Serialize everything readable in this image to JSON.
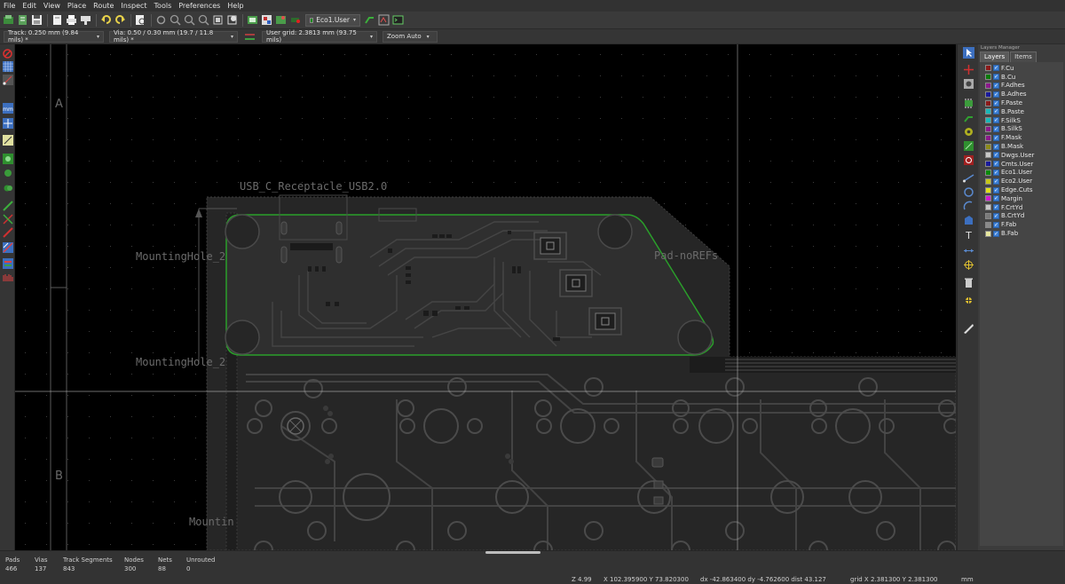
{
  "menubar": [
    "File",
    "Edit",
    "View",
    "Place",
    "Route",
    "Inspect",
    "Tools",
    "Preferences",
    "Help"
  ],
  "toolbar": {
    "layer_select": "Eco1.User"
  },
  "aux_toolbar": {
    "track": "Track: 0.250 mm (9.84 mils) *",
    "via": "Via: 0.50 / 0.30 mm (19.7 / 11.8 mils) *",
    "grid": "User grid: 2.3813 mm (93.75 mils)",
    "zoom": "Zoom Auto"
  },
  "canvas": {
    "frame_labels": [
      "A",
      "B"
    ],
    "footprint_labels": {
      "usb": "USB_C_Receptacle_USB2.0",
      "hole_1": "MountingHole_2",
      "hole_2": "MountingHole_2",
      "hole_3": "Mountin",
      "pad_ref": "Pad-noREFs"
    }
  },
  "layers_panel": {
    "title": "Layers Manager",
    "tabs": [
      "Layers",
      "Items"
    ],
    "layers": [
      {
        "name": "F.Cu",
        "color": "#8b1a1a"
      },
      {
        "name": "B.Cu",
        "color": "#0a7a0a"
      },
      {
        "name": "F.Adhes",
        "color": "#8b1a8b"
      },
      {
        "name": "B.Adhes",
        "color": "#1a1a9a"
      },
      {
        "name": "F.Paste",
        "color": "#8b1a1a"
      },
      {
        "name": "B.Paste",
        "color": "#1ab8b8"
      },
      {
        "name": "F.SilkS",
        "color": "#1ab8b8"
      },
      {
        "name": "B.SilkS",
        "color": "#8b1a8b"
      },
      {
        "name": "F.Mask",
        "color": "#8b1a8b"
      },
      {
        "name": "B.Mask",
        "color": "#8b8b1a"
      },
      {
        "name": "Dwgs.User",
        "color": "#c8c8c8"
      },
      {
        "name": "Cmts.User",
        "color": "#1a1a9a"
      },
      {
        "name": "Eco1.User",
        "color": "#0a8a0a"
      },
      {
        "name": "Eco2.User",
        "color": "#c8c81a"
      },
      {
        "name": "Edge.Cuts",
        "color": "#e0e01a"
      },
      {
        "name": "Margin",
        "color": "#d01ad0"
      },
      {
        "name": "F.CrtYd",
        "color": "#c8c8c8"
      },
      {
        "name": "B.CrtYd",
        "color": "#7a7a7a"
      },
      {
        "name": "F.Fab",
        "color": "#8a8a8a"
      },
      {
        "name": "B.Fab",
        "color": "#e8e8a0"
      }
    ]
  },
  "status": {
    "stats": [
      {
        "label": "Pads",
        "value": "466"
      },
      {
        "label": "Vias",
        "value": "137"
      },
      {
        "label": "Track Segments",
        "value": "843"
      },
      {
        "label": "Nodes",
        "value": "300"
      },
      {
        "label": "Nets",
        "value": "88"
      },
      {
        "label": "Unrouted",
        "value": "0"
      }
    ],
    "zoom": "Z 4.99",
    "coords": "X 102.395900  Y 73.820300",
    "delta": "dx -42.863400  dy -4.762600  dist 43.127",
    "grid": "grid X 2.381300  Y 2.381300",
    "units": "mm"
  }
}
